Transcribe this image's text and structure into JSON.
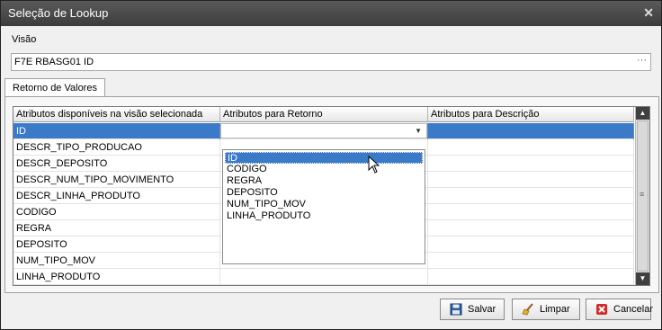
{
  "window": {
    "title": "Seleção de Lookup"
  },
  "visao": {
    "label": "Visão",
    "value": "F7E RBASG01 ID",
    "browse": "···"
  },
  "tabs": [
    {
      "label": "Retorno de Valores"
    }
  ],
  "grid": {
    "columns": [
      "Atributos disponíveis na visão selecionada",
      "Atributos para Retorno",
      "Atributos para Descrição"
    ],
    "rows": [
      "ID",
      "DESCR_TIPO_PRODUCAO",
      "DESCR_DEPOSITO",
      "DESCR_NUM_TIPO_MOVIMENTO",
      "DESCR_LINHA_PRODUTO",
      "CODIGO",
      "REGRA",
      "DEPOSITO",
      "NUM_TIPO_MOV",
      "LINHA_PRODUTO"
    ],
    "selected_row": "ID"
  },
  "dropdown": {
    "options": [
      "ID",
      "CODIGO",
      "REGRA",
      "DEPOSITO",
      "NUM_TIPO_MOV",
      "LINHA_PRODUTO"
    ],
    "highlighted": "ID"
  },
  "buttons": {
    "save": "Salvar",
    "clear": "Limpar",
    "cancel": "Cancelar"
  },
  "icons": {
    "close": "close-icon",
    "save": "floppy-icon",
    "clear": "broom-icon",
    "cancel": "red-x-icon"
  },
  "colors": {
    "selection": "#3b79c9",
    "titlebar": "#4a4a4a"
  }
}
